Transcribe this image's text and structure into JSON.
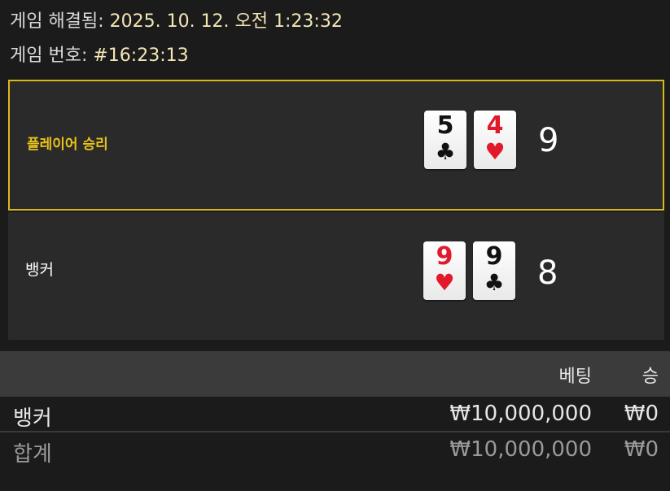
{
  "game_info": {
    "resolved_label": "게임 해결됨:",
    "resolved_value": "2025. 10. 12. 오전 1:23:32",
    "number_label": "게임 번호:",
    "number_value": "#16:23:13"
  },
  "hands": {
    "player": {
      "label": "플레이어 승리",
      "total": "9",
      "cards": [
        {
          "rank": "5",
          "suit": "♣",
          "color": "black"
        },
        {
          "rank": "4",
          "suit": "♥",
          "color": "red"
        }
      ]
    },
    "banker": {
      "label": "뱅커",
      "total": "8",
      "cards": [
        {
          "rank": "9",
          "suit": "♥",
          "color": "red"
        },
        {
          "rank": "9",
          "suit": "♣",
          "color": "black"
        }
      ]
    }
  },
  "bets_table": {
    "headers": {
      "bet": "베팅",
      "win": "승"
    },
    "rows": [
      {
        "name": "뱅커",
        "bet": "₩10,000,000",
        "win": "₩0"
      }
    ],
    "total": {
      "name": "합계",
      "bet": "₩10,000,000",
      "win": "₩0"
    }
  },
  "colors": {
    "accent_gold": "#d9b71d",
    "card_red": "#e1192b"
  }
}
